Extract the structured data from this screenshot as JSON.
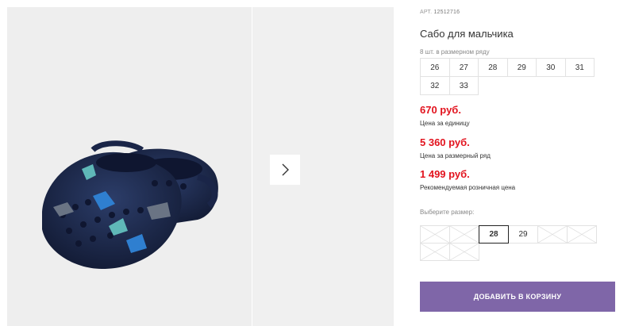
{
  "product": {
    "article_label": "АРТ.",
    "article_value": "12512716",
    "title": "Сабо для мальчика",
    "row_caption": "8 шт. в размерном ряду",
    "size_row": [
      "26",
      "27",
      "28",
      "29",
      "30",
      "31",
      "32",
      "33"
    ]
  },
  "prices": [
    {
      "value": "670 руб.",
      "label": "Цена за единицу"
    },
    {
      "value": "5 360 руб.",
      "label": "Цена за размерный ряд"
    },
    {
      "value": "1 499 руб.",
      "label": "Рекомендуемая розничная цена"
    }
  ],
  "size_picker": {
    "label": "Выберите размер:",
    "options": [
      {
        "size": "",
        "available": false,
        "selected": false
      },
      {
        "size": "",
        "available": false,
        "selected": false
      },
      {
        "size": "28",
        "available": true,
        "selected": true
      },
      {
        "size": "29",
        "available": true,
        "selected": false
      },
      {
        "size": "",
        "available": false,
        "selected": false
      },
      {
        "size": "",
        "available": false,
        "selected": false
      },
      {
        "size": "",
        "available": false,
        "selected": false
      },
      {
        "size": "",
        "available": false,
        "selected": false
      }
    ]
  },
  "cart_button": {
    "label": "ДОБАВИТЬ В КОРЗИНУ"
  },
  "gallery": {
    "next_icon": "chevron-right-icon"
  },
  "colors": {
    "price": "#e2131e",
    "button": "#7f66a8",
    "shoe": "#1f2d52"
  }
}
